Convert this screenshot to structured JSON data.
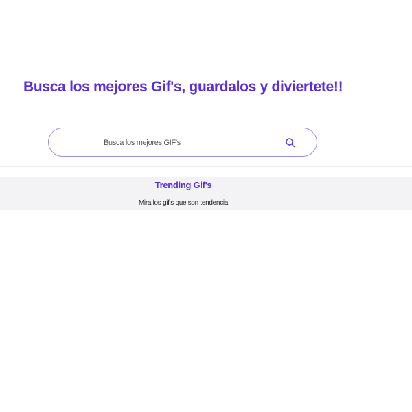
{
  "header": {
    "title": "Busca los mejores Gif's, guardalos y diviertete!!"
  },
  "search": {
    "placeholder": "Busca los mejores GIF's",
    "value": "",
    "icon": "search-icon"
  },
  "trending": {
    "title": "Trending Gif's",
    "subtitle": "Mira los gif's que son tendencia"
  },
  "colors": {
    "accent": "#572ee5",
    "search_border": "#9a8ae8",
    "band_background": "#f3f3f6"
  }
}
